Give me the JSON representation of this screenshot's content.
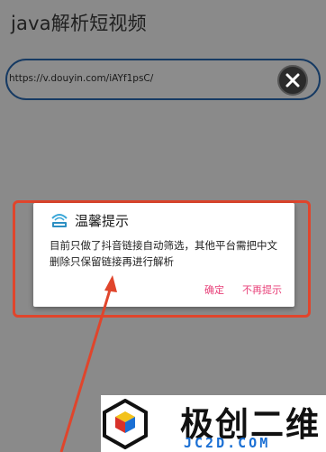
{
  "app": {
    "title": "java解析短视频"
  },
  "url_field": {
    "value": "https://v.douyin.com/iAYf1psC/"
  },
  "clear_button": {
    "icon": "close-icon"
  },
  "dialog": {
    "icon": "app-logo-icon",
    "title": "温馨提示",
    "message": "目前只做了抖音链接自动筛选，其他平台需把中文删除只保留链接再进行解析",
    "confirm_label": "确定",
    "dismiss_label": "不再提示"
  },
  "annotation": {
    "color": "#e0452c"
  },
  "watermark": {
    "name": "极创二维",
    "domain": "JC2D.COM"
  },
  "colors": {
    "accent": "#e8427a",
    "frame": "#163a63",
    "overlay": "#8a8a8a"
  }
}
